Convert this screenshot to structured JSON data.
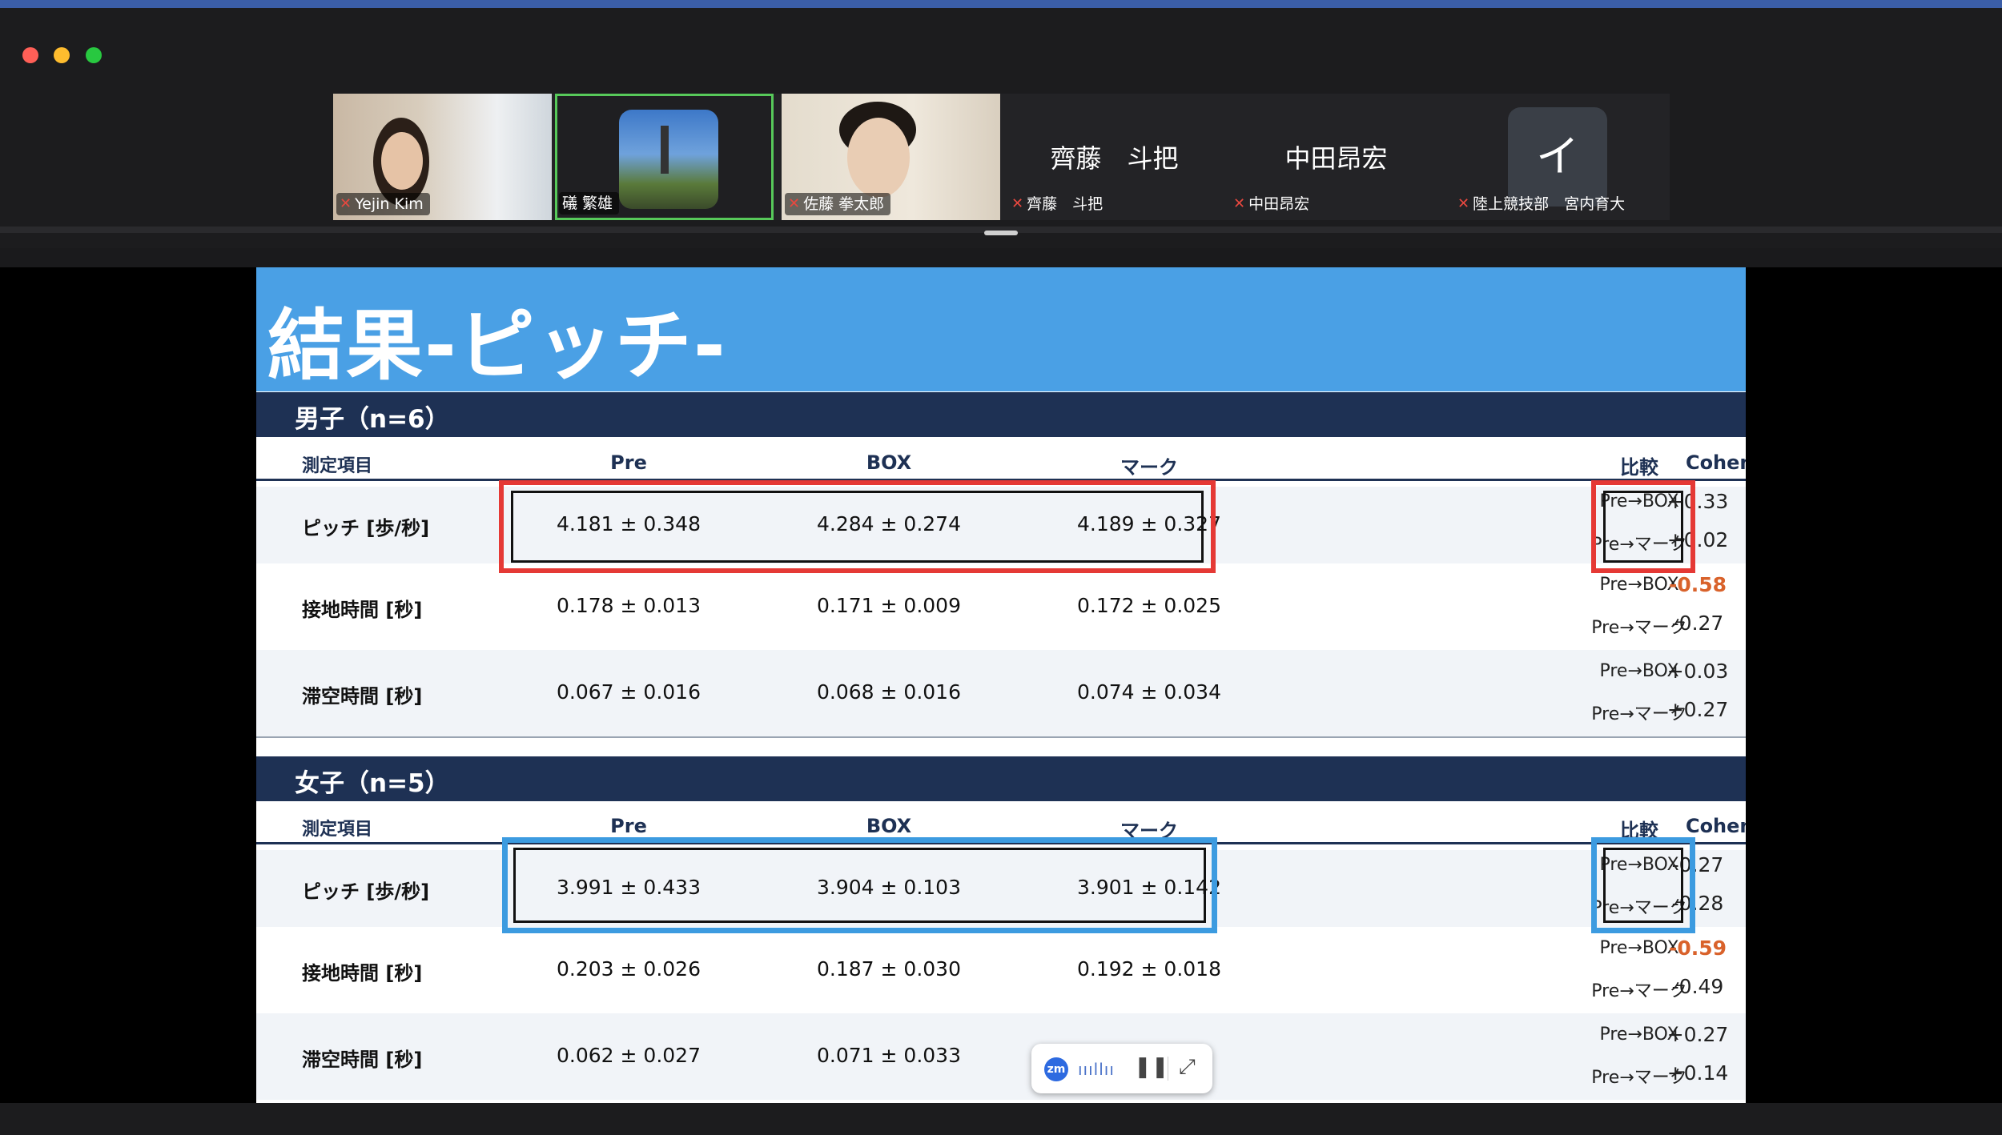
{
  "participants": [
    {
      "name": "Yejin Kim",
      "type": "video"
    },
    {
      "name": "礒 繁雄",
      "type": "image",
      "active_speaker": true
    },
    {
      "name": "佐藤 拳太郎",
      "type": "video"
    },
    {
      "name": "齊藤　斗把",
      "display": "齊藤　斗把",
      "type": "name"
    },
    {
      "name": "中田昂宏",
      "display": "中田昂宏",
      "type": "name"
    },
    {
      "name": "陸上競技部　宮内育大",
      "display": "イ",
      "type": "letter"
    }
  ],
  "slide": {
    "title": "結果-ピッチ-",
    "columns": {
      "item": "測定項目",
      "pre": "Pre",
      "box": "BOX",
      "mark": "マーク",
      "comparison": "比較",
      "cohen": "Cohen d"
    },
    "comparisons": [
      "Pre→BOX",
      "Pre→マーク"
    ],
    "sections": [
      {
        "label": "男子（n=6）",
        "rows": [
          {
            "item": "ピッチ [歩/秒]",
            "pre": "4.181 ± 0.348",
            "box": "4.284 ± 0.274",
            "mark": "4.189 ± 0.327",
            "d1": "+0.33",
            "d2": "+0.02"
          },
          {
            "item": "接地時間 [秒]",
            "pre": "0.178 ± 0.013",
            "box": "0.171 ± 0.009",
            "mark": "0.172 ± 0.025",
            "d1": "-0.58",
            "d2": "-0.27"
          },
          {
            "item": "滞空時間 [秒]",
            "pre": "0.067 ± 0.016",
            "box": "0.068 ± 0.016",
            "mark": "0.074 ± 0.034",
            "d1": "+0.03",
            "d2": "+0.27"
          }
        ]
      },
      {
        "label": "女子（n=5）",
        "rows": [
          {
            "item": "ピッチ [歩/秒]",
            "pre": "3.991 ± 0.433",
            "box": "3.904 ± 0.103",
            "mark": "3.901 ± 0.142",
            "d1": "-0.27",
            "d2": "-0.28"
          },
          {
            "item": "接地時間 [秒]",
            "pre": "0.203 ± 0.026",
            "box": "0.187 ± 0.030",
            "mark": "0.192 ± 0.018",
            "d1": "-0.59",
            "d2": "-0.49"
          },
          {
            "item": "滞空時間 [秒]",
            "pre": "0.062 ± 0.027",
            "box": "0.071 ± 0.033",
            "mark": "",
            "d1": "+0.27",
            "d2": "+0.14"
          }
        ]
      }
    ]
  },
  "screen_share_controls": {
    "logo": "zm",
    "audio_indicator": "ıııllıı",
    "pause_icon": "pause-icon",
    "expand_icon": "expand-icon"
  },
  "colors": {
    "header_blue": "#4aa0e5",
    "section_navy": "#1e3154",
    "highlight_red": "#e53935",
    "highlight_blue": "#3c9be0",
    "negative_orange": "#d9622b",
    "active_speaker_green": "#57c95a"
  }
}
